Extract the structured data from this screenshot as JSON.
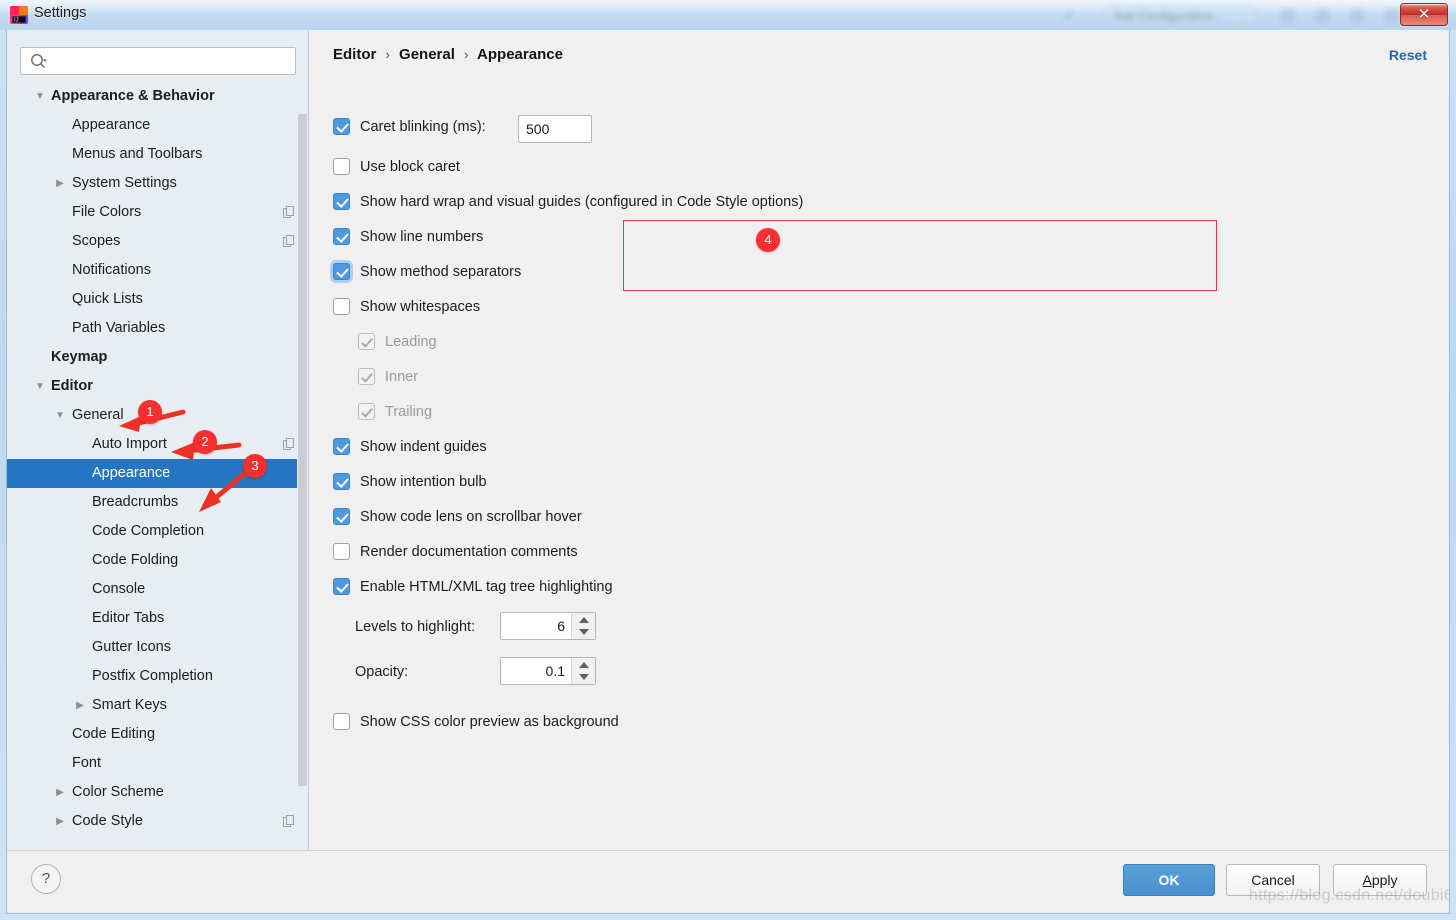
{
  "window": {
    "title": "Settings",
    "app_icon": "intellij-logo-icon",
    "close_label": "✕",
    "ghost_toolbar": {
      "wrench_icon": "wrench-icon",
      "run_configuration": "Add Configuration..."
    }
  },
  "sidebar": {
    "search": {
      "placeholder": "",
      "value": "",
      "icon": "search-icon"
    },
    "items": [
      {
        "label": "Appearance & Behavior",
        "depth": 0,
        "bold": true,
        "arrow": "down",
        "selected": false,
        "copy": false
      },
      {
        "label": "Appearance",
        "depth": 1,
        "bold": false,
        "arrow": "none",
        "selected": false,
        "copy": false
      },
      {
        "label": "Menus and Toolbars",
        "depth": 1,
        "bold": false,
        "arrow": "none",
        "selected": false,
        "copy": false
      },
      {
        "label": "System Settings",
        "depth": 1,
        "bold": false,
        "arrow": "right",
        "selected": false,
        "copy": false
      },
      {
        "label": "File Colors",
        "depth": 1,
        "bold": false,
        "arrow": "none",
        "selected": false,
        "copy": true
      },
      {
        "label": "Scopes",
        "depth": 1,
        "bold": false,
        "arrow": "none",
        "selected": false,
        "copy": true
      },
      {
        "label": "Notifications",
        "depth": 1,
        "bold": false,
        "arrow": "none",
        "selected": false,
        "copy": false
      },
      {
        "label": "Quick Lists",
        "depth": 1,
        "bold": false,
        "arrow": "none",
        "selected": false,
        "copy": false
      },
      {
        "label": "Path Variables",
        "depth": 1,
        "bold": false,
        "arrow": "none",
        "selected": false,
        "copy": false
      },
      {
        "label": "Keymap",
        "depth": 0,
        "bold": true,
        "arrow": "none",
        "selected": false,
        "copy": false
      },
      {
        "label": "Editor",
        "depth": 0,
        "bold": true,
        "arrow": "down",
        "selected": false,
        "copy": false
      },
      {
        "label": "General",
        "depth": 1,
        "bold": false,
        "arrow": "down",
        "selected": false,
        "copy": false
      },
      {
        "label": "Auto Import",
        "depth": 2,
        "bold": false,
        "arrow": "none",
        "selected": false,
        "copy": true
      },
      {
        "label": "Appearance",
        "depth": 2,
        "bold": false,
        "arrow": "none",
        "selected": true,
        "copy": false
      },
      {
        "label": "Breadcrumbs",
        "depth": 2,
        "bold": false,
        "arrow": "none",
        "selected": false,
        "copy": false
      },
      {
        "label": "Code Completion",
        "depth": 2,
        "bold": false,
        "arrow": "none",
        "selected": false,
        "copy": false
      },
      {
        "label": "Code Folding",
        "depth": 2,
        "bold": false,
        "arrow": "none",
        "selected": false,
        "copy": false
      },
      {
        "label": "Console",
        "depth": 2,
        "bold": false,
        "arrow": "none",
        "selected": false,
        "copy": false
      },
      {
        "label": "Editor Tabs",
        "depth": 2,
        "bold": false,
        "arrow": "none",
        "selected": false,
        "copy": false
      },
      {
        "label": "Gutter Icons",
        "depth": 2,
        "bold": false,
        "arrow": "none",
        "selected": false,
        "copy": false
      },
      {
        "label": "Postfix Completion",
        "depth": 2,
        "bold": false,
        "arrow": "none",
        "selected": false,
        "copy": false
      },
      {
        "label": "Smart Keys",
        "depth": 2,
        "bold": false,
        "arrow": "right",
        "selected": false,
        "copy": false
      },
      {
        "label": "Code Editing",
        "depth": 1,
        "bold": false,
        "arrow": "none",
        "selected": false,
        "copy": false
      },
      {
        "label": "Font",
        "depth": 1,
        "bold": false,
        "arrow": "none",
        "selected": false,
        "copy": false
      },
      {
        "label": "Color Scheme",
        "depth": 1,
        "bold": false,
        "arrow": "right",
        "selected": false,
        "copy": false
      },
      {
        "label": "Code Style",
        "depth": 1,
        "bold": false,
        "arrow": "right",
        "selected": false,
        "copy": true
      }
    ]
  },
  "content": {
    "breadcrumb": {
      "part1": "Editor",
      "part2": "General",
      "part3": "Appearance",
      "separator": "›"
    },
    "reset_label": "Reset",
    "caret_blinking": {
      "label": "Caret blinking (ms):",
      "value": "500",
      "checked": true
    },
    "options": [
      {
        "label": "Use block caret",
        "checked": false,
        "disabled": false,
        "indent": 0,
        "focused": false
      },
      {
        "label": "Show hard wrap and visual guides (configured in Code Style options)",
        "checked": true,
        "disabled": false,
        "indent": 0,
        "focused": false
      },
      {
        "label": "Show line numbers",
        "checked": true,
        "disabled": false,
        "indent": 0,
        "focused": false
      },
      {
        "label": "Show method separators",
        "checked": true,
        "disabled": false,
        "indent": 0,
        "focused": true
      },
      {
        "label": "Show whitespaces",
        "checked": false,
        "disabled": false,
        "indent": 0,
        "focused": false
      },
      {
        "label": "Leading",
        "checked": true,
        "disabled": true,
        "indent": 1,
        "focused": false
      },
      {
        "label": "Inner",
        "checked": true,
        "disabled": true,
        "indent": 1,
        "focused": false
      },
      {
        "label": "Trailing",
        "checked": true,
        "disabled": true,
        "indent": 1,
        "focused": false
      },
      {
        "label": "Show indent guides",
        "checked": true,
        "disabled": false,
        "indent": 0,
        "focused": false
      },
      {
        "label": "Show intention bulb",
        "checked": true,
        "disabled": false,
        "indent": 0,
        "focused": false
      },
      {
        "label": "Show code lens on scrollbar hover",
        "checked": true,
        "disabled": false,
        "indent": 0,
        "focused": false
      },
      {
        "label": "Render documentation comments",
        "checked": false,
        "disabled": false,
        "indent": 0,
        "focused": false
      },
      {
        "label": "Enable HTML/XML tag tree highlighting",
        "checked": true,
        "disabled": false,
        "indent": 0,
        "focused": false
      }
    ],
    "spinners": [
      {
        "label": "Levels to highlight:",
        "value": "6"
      },
      {
        "label": "Opacity:",
        "value": "0.1"
      }
    ],
    "css_preview": {
      "label": "Show CSS color preview as background",
      "checked": false
    }
  },
  "annotations": {
    "accent_color": "#f7302f",
    "markers": [
      {
        "number": "1",
        "target": "sidebar-item-editor"
      },
      {
        "number": "2",
        "target": "sidebar-item-general"
      },
      {
        "number": "3",
        "target": "sidebar-item-appearance"
      },
      {
        "number": "4",
        "target": "highlighted-options-group"
      }
    ]
  },
  "footer": {
    "help_label": "?",
    "ok_label": "OK",
    "cancel_label": "Cancel",
    "apply_mnemonic": "A",
    "apply_rest": "pply"
  },
  "watermark": "https://blog.csdn.net/doubi6"
}
